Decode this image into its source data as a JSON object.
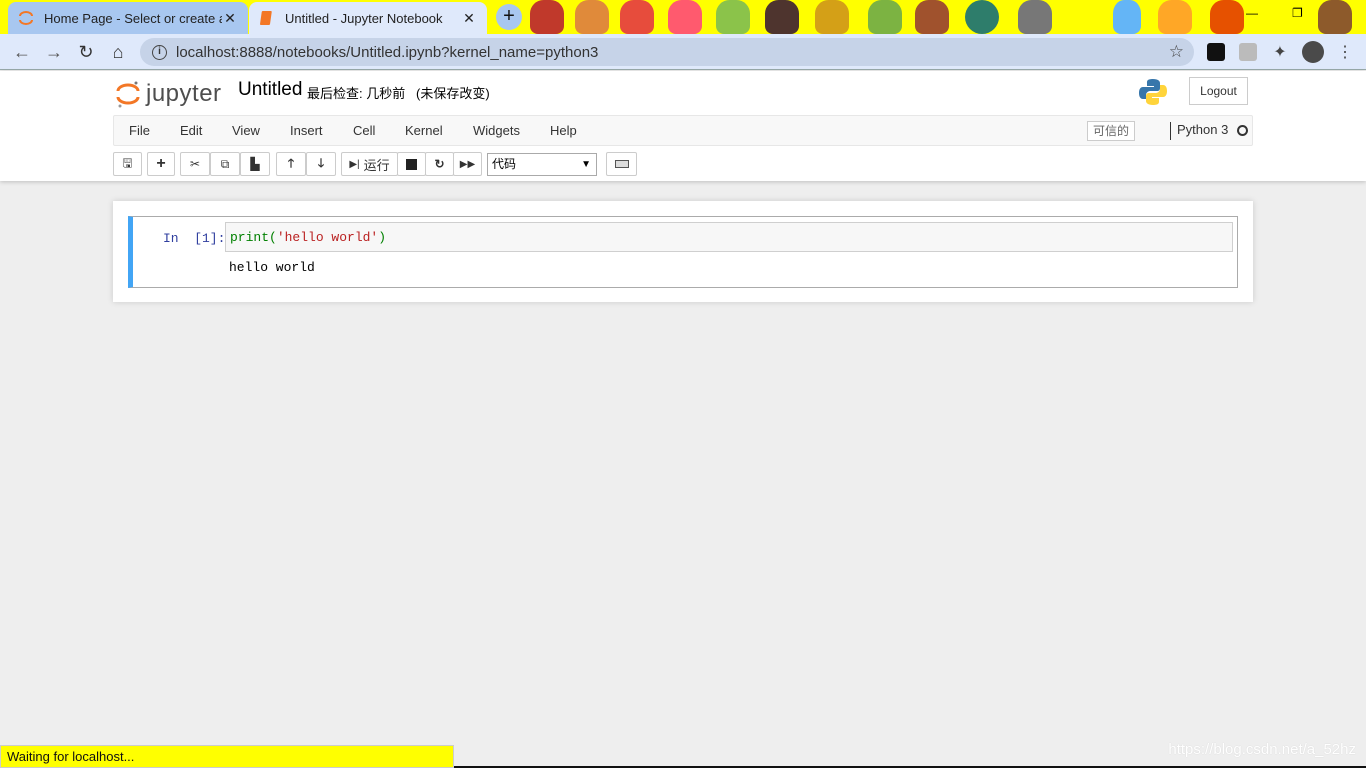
{
  "browser": {
    "tabs": [
      {
        "title": "Home Page - Select or create a notebook",
        "active": false
      },
      {
        "title": "Untitled - Jupyter Notebook",
        "active": true
      }
    ],
    "url": "localhost:8888/notebooks/Untitled.ipynb?kernel_name=python3",
    "status": "Waiting for localhost...",
    "watermark": "https://blog.csdn.net/a_52hz"
  },
  "header": {
    "logo_text": "jupyter",
    "notebook_name": "Untitled",
    "checkpoint": "最后检查: 几秒前",
    "unsaved": "(未保存改变)",
    "logout": "Logout"
  },
  "menubar": {
    "items": [
      "File",
      "Edit",
      "View",
      "Insert",
      "Cell",
      "Kernel",
      "Widgets",
      "Help"
    ],
    "trusted": "可信的",
    "kernel_name": "Python 3"
  },
  "toolbar": {
    "run_label": "运行",
    "cell_type": "代码"
  },
  "cell": {
    "prompt": "In  [1]:",
    "code_fn": "print(",
    "code_str": "'hello world'",
    "code_close": ")",
    "output": "hello world"
  },
  "colors": {
    "accent": "#42a5f5",
    "tabstrip": "#ffff00",
    "jupyter_orange": "#f37726"
  }
}
